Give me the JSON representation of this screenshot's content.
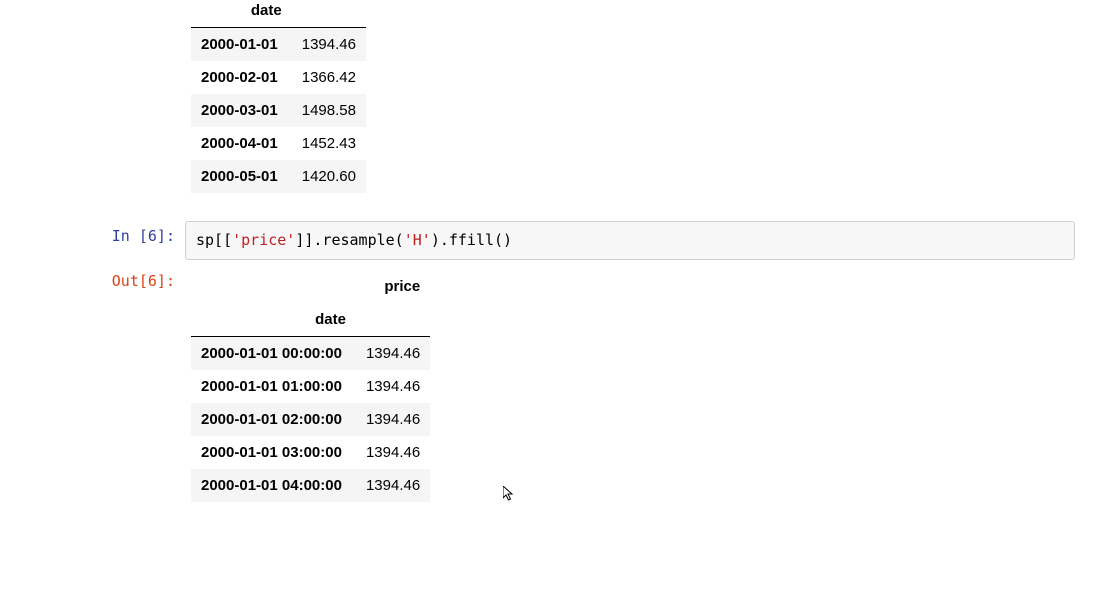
{
  "prev_output": {
    "index_name": "date",
    "columns": [],
    "rows": [
      {
        "idx": "2000-01-01",
        "val": "1394.46"
      },
      {
        "idx": "2000-02-01",
        "val": "1366.42"
      },
      {
        "idx": "2000-03-01",
        "val": "1498.58"
      },
      {
        "idx": "2000-04-01",
        "val": "1452.43"
      },
      {
        "idx": "2000-05-01",
        "val": "1420.60"
      }
    ]
  },
  "cell6": {
    "in_label": "In [6]:",
    "out_label": "Out[6]:",
    "code_parts": {
      "p1": "sp[[",
      "s1": "'price'",
      "p2": "]].resample(",
      "s2": "'H'",
      "p3": ").ffill()"
    },
    "output": {
      "col_name": "price",
      "index_name": "date",
      "rows": [
        {
          "idx": "2000-01-01 00:00:00",
          "val": "1394.46"
        },
        {
          "idx": "2000-01-01 01:00:00",
          "val": "1394.46"
        },
        {
          "idx": "2000-01-01 02:00:00",
          "val": "1394.46"
        },
        {
          "idx": "2000-01-01 03:00:00",
          "val": "1394.46"
        },
        {
          "idx": "2000-01-01 04:00:00",
          "val": "1394.46"
        }
      ]
    }
  }
}
